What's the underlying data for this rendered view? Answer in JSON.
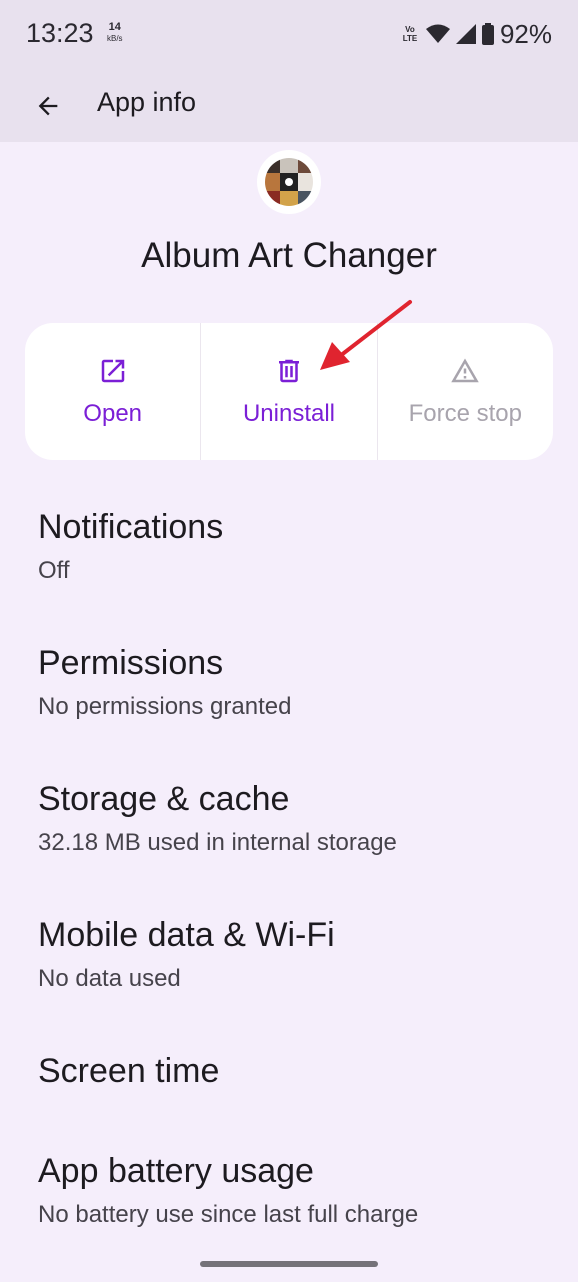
{
  "status_bar": {
    "time": "13:23",
    "net_speed": "14",
    "net_speed_unit": "kB/s",
    "volte_line1": "Vo",
    "volte_line2": "LTE",
    "battery": "92%"
  },
  "app_bar": {
    "title": "App info",
    "back_icon": "arrow-back-icon"
  },
  "app": {
    "name": "Album Art Changer",
    "icon": "album-collage-icon"
  },
  "actions": [
    {
      "label": "Open",
      "icon": "open-external-icon",
      "enabled": true
    },
    {
      "label": "Uninstall",
      "icon": "trash-icon",
      "enabled": true
    },
    {
      "label": "Force stop",
      "icon": "warning-icon",
      "enabled": false
    }
  ],
  "annotation": {
    "arrow_color": "#e0242f"
  },
  "settings": [
    {
      "title": "Notifications",
      "summary": "Off"
    },
    {
      "title": "Permissions",
      "summary": "No permissions granted"
    },
    {
      "title": "Storage & cache",
      "summary": "32.18 MB used in internal storage"
    },
    {
      "title": "Mobile data & Wi-Fi",
      "summary": "No data used"
    },
    {
      "title": "Screen time",
      "summary": ""
    },
    {
      "title": "App battery usage",
      "summary": "No battery use since last full charge"
    }
  ],
  "colors": {
    "accent": "#7b1fd6",
    "background": "#f5eefb",
    "appbar": "#e8e1ee",
    "disabled": "#a8a4ad"
  }
}
